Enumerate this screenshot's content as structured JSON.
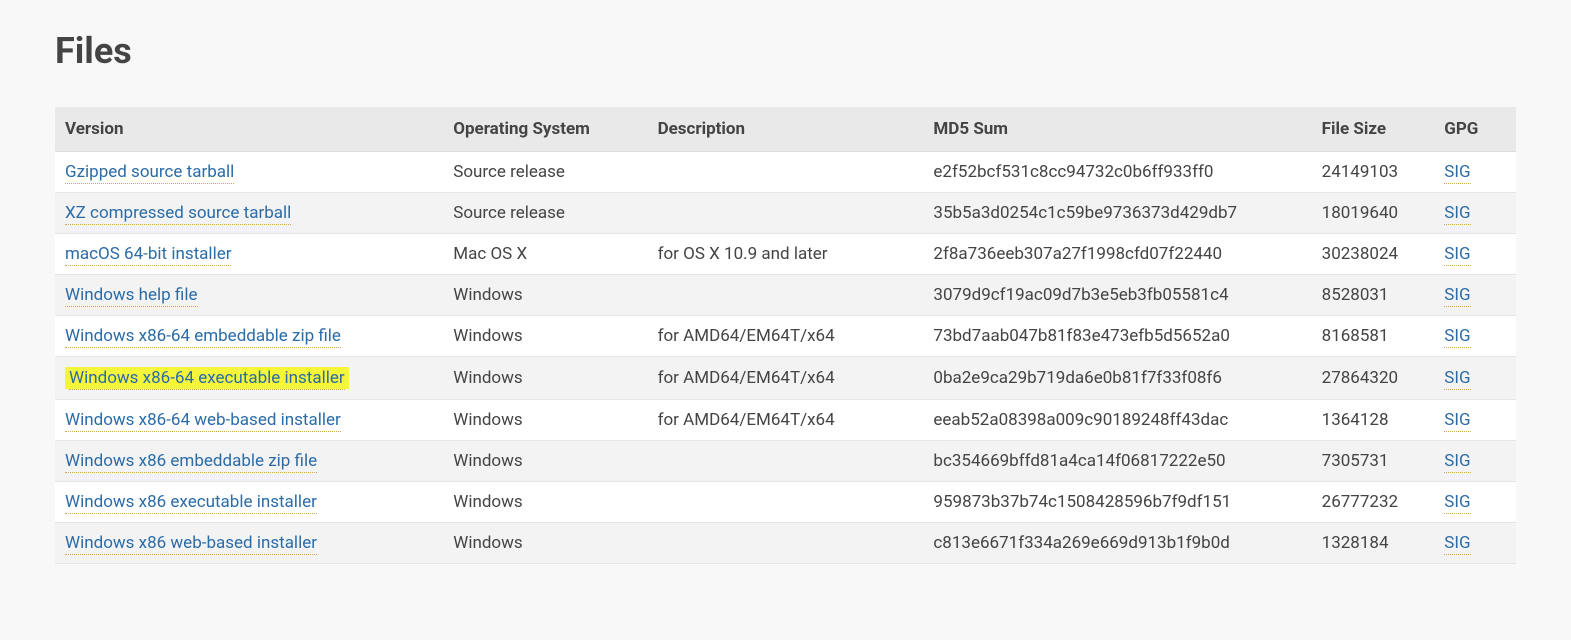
{
  "title": "Files",
  "headers": {
    "version": "Version",
    "os": "Operating System",
    "description": "Description",
    "md5": "MD5 Sum",
    "size": "File Size",
    "gpg": "GPG"
  },
  "sig_label": "SIG",
  "rows": [
    {
      "version": "Gzipped source tarball",
      "os": "Source release",
      "description": "",
      "md5": "e2f52bcf531c8cc94732c0b6ff933ff0",
      "size": "24149103",
      "highlighted": false
    },
    {
      "version": "XZ compressed source tarball",
      "os": "Source release",
      "description": "",
      "md5": "35b5a3d0254c1c59be9736373d429db7",
      "size": "18019640",
      "highlighted": false
    },
    {
      "version": "macOS 64-bit installer",
      "os": "Mac OS X",
      "description": "for OS X 10.9 and later",
      "md5": "2f8a736eeb307a27f1998cfd07f22440",
      "size": "30238024",
      "highlighted": false
    },
    {
      "version": "Windows help file",
      "os": "Windows",
      "description": "",
      "md5": "3079d9cf19ac09d7b3e5eb3fb05581c4",
      "size": "8528031",
      "highlighted": false
    },
    {
      "version": "Windows x86-64 embeddable zip file",
      "os": "Windows",
      "description": "for AMD64/EM64T/x64",
      "md5": "73bd7aab047b81f83e473efb5d5652a0",
      "size": "8168581",
      "highlighted": false
    },
    {
      "version": "Windows x86-64 executable installer",
      "os": "Windows",
      "description": "for AMD64/EM64T/x64",
      "md5": "0ba2e9ca29b719da6e0b81f7f33f08f6",
      "size": "27864320",
      "highlighted": true
    },
    {
      "version": "Windows x86-64 web-based installer",
      "os": "Windows",
      "description": "for AMD64/EM64T/x64",
      "md5": "eeab52a08398a009c90189248ff43dac",
      "size": "1364128",
      "highlighted": false
    },
    {
      "version": "Windows x86 embeddable zip file",
      "os": "Windows",
      "description": "",
      "md5": "bc354669bffd81a4ca14f06817222e50",
      "size": "7305731",
      "highlighted": false
    },
    {
      "version": "Windows x86 executable installer",
      "os": "Windows",
      "description": "",
      "md5": "959873b37b74c1508428596b7f9df151",
      "size": "26777232",
      "highlighted": false
    },
    {
      "version": "Windows x86 web-based installer",
      "os": "Windows",
      "description": "",
      "md5": "c813e6671f334a269e669d913b1f9b0d",
      "size": "1328184",
      "highlighted": false
    }
  ]
}
